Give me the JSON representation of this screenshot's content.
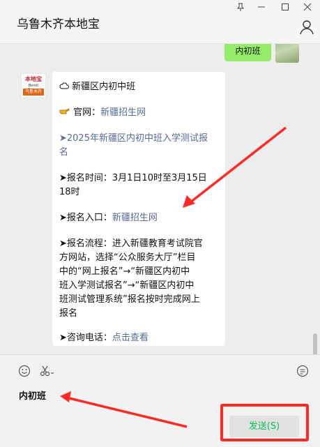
{
  "window": {
    "title": "乌鲁木齐本地宝",
    "controls": [
      "pin-icon",
      "minimize-icon",
      "maximize-icon",
      "close-icon"
    ]
  },
  "chat": {
    "self_message": "内初班",
    "bot_avatar": {
      "line1": "本地宝",
      "line2": "Bendi Baoao",
      "line3": "乌鲁木齐"
    },
    "bot_message": {
      "title": "新疆区内初中班",
      "official_site_label": "官网：",
      "official_site_link": "新疆招生网",
      "notice_line1": "➤2025年新疆区内初中班入学测试报",
      "notice_line2": "名",
      "time_line1": "➤报名时间：3月1日10时至3月15日",
      "time_line2": "18时",
      "entry_label": "➤报名入口：",
      "entry_link": "新疆招生网",
      "process_line1": "➤报名流程：进入新疆教育考试院官",
      "process_line2": "方网站，选择“公众服务大厅”栏目",
      "process_line3": "中的“网上报名”→“新疆区内初中",
      "process_line4": "班入学测试报名”→“新疆区内初中",
      "process_line5": "班测试管理系统”报名按时完成网上",
      "process_line6": "报名",
      "phone_label": "➤咨询电话：",
      "phone_link": "点击查看"
    }
  },
  "composer": {
    "input_value": "内初班",
    "send_label": "发送(S)"
  },
  "colors": {
    "self_bubble": "#95ec69",
    "link": "#576b95",
    "send_text": "#07c160",
    "annotation_red": "#ff2a25"
  }
}
